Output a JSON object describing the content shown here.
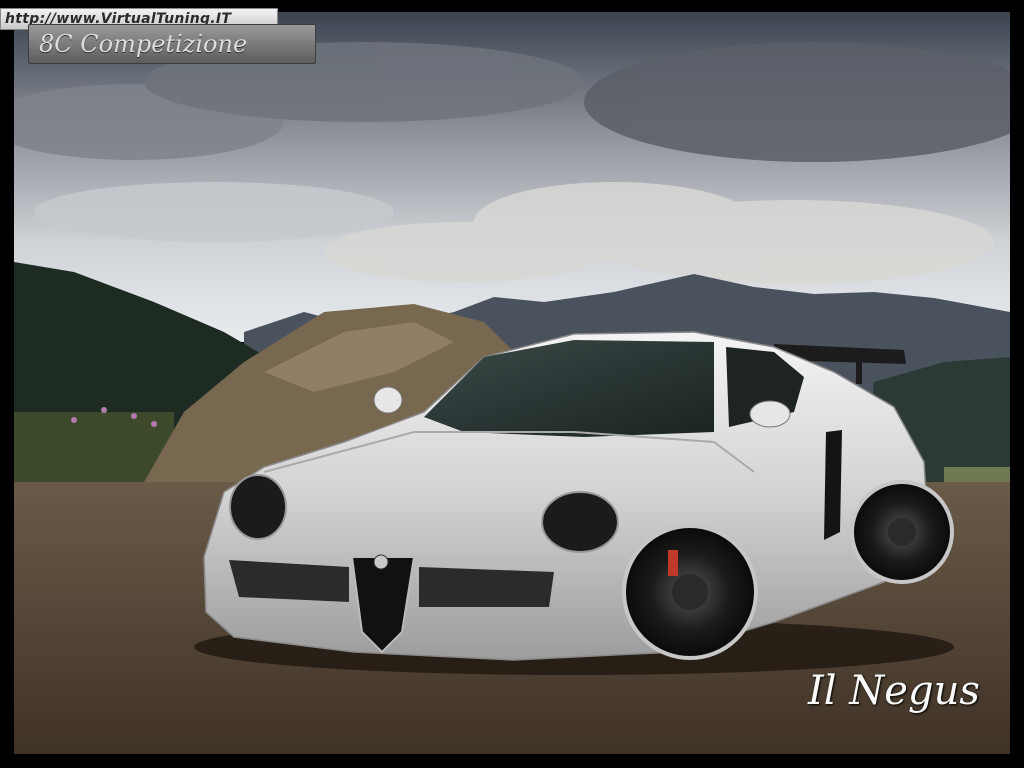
{
  "image": {
    "description_tag": "photo-scene",
    "watermark_url": "http://www.VirtualTuning.IT",
    "model_name": "8C Competizione",
    "signature": "Il Negus",
    "colors": {
      "frame": "#000000",
      "sky_top": "#3c4656",
      "cloud": "#d9d9d6",
      "mountain": "#3f4752",
      "ground": "#5b4a3b",
      "car_body": "#dcdcdc",
      "rock": "#7a6a52"
    }
  }
}
